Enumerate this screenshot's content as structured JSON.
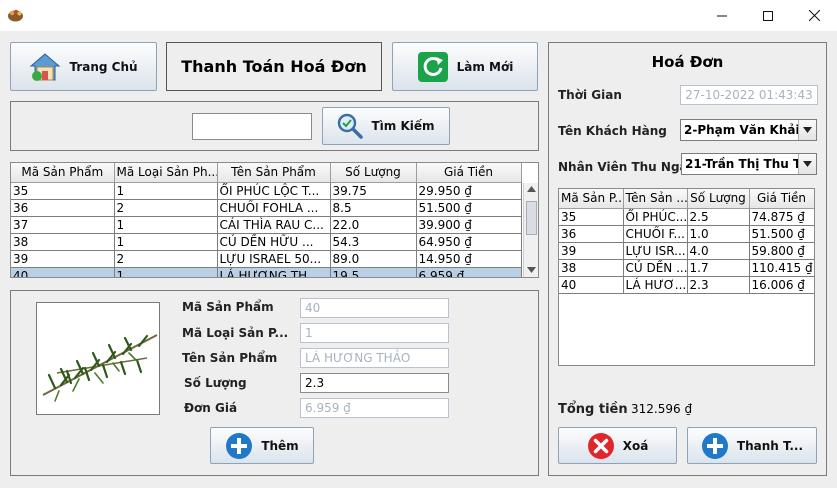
{
  "window": {
    "minimize_glyph": "—",
    "maximize_glyph": "☐",
    "close_glyph": "✕"
  },
  "header": {
    "home_label": "Trang Chủ",
    "page_title": "Thanh Toán Hoá Đơn",
    "refresh_label": "Làm Mới"
  },
  "search": {
    "value": "",
    "button_label": "Tìm Kiếm"
  },
  "product_table": {
    "columns": [
      "Mã Sản Phẩm",
      "Mã Loại Sản Ph...",
      "Tên Sản Phẩm",
      "Số Lượng",
      "Giá Tiền"
    ],
    "rows": [
      [
        "35",
        "1",
        "ỔI PHÚC LỘC T...",
        "39.75",
        "29.950 ₫"
      ],
      [
        "36",
        "2",
        "CHUỐI FOHLA ...",
        "8.5",
        "51.500 ₫"
      ],
      [
        "37",
        "1",
        "CẢI THÌA RAU C...",
        "22.0",
        "39.900 ₫"
      ],
      [
        "38",
        "1",
        "CỦ DỀN HỮU ...",
        "54.3",
        "64.950 ₫"
      ],
      [
        "39",
        "2",
        "LỰU ISRAEL 50...",
        "89.0",
        "14.950 ₫"
      ],
      [
        "40",
        "1",
        "LÁ HƯƠNG TH...",
        "19.5",
        "6.959 ₫"
      ]
    ],
    "selected_index": 5
  },
  "detail": {
    "labels": {
      "product_id": "Mã Sản Phẩm",
      "category_id": "Mã Loại Sản P...",
      "product_name": "Tên Sản Phẩm",
      "quantity": "Số Lượng",
      "unit_price": "Đơn Giá"
    },
    "values": {
      "product_id": "40",
      "category_id": "1",
      "product_name": "LÁ HƯƠNG THẢO",
      "quantity": "2.3",
      "unit_price": "6.959 ₫"
    },
    "add_label": "Thêm"
  },
  "invoice": {
    "title": "Hoá Đơn",
    "time_label": "Thời Gian",
    "time_value": "27-10-2022 01:43:43",
    "customer_label": "Tên Khách Hàng",
    "customer_value": "2-Phạm Văn Khải",
    "cashier_label": "Nhân Viên Thu Ngân",
    "cashier_value": "21-Trần Thị Thu T...",
    "columns": [
      "Mã Sản P...",
      "Tên Sản ...",
      "Số Lượng",
      "Giá Tiền"
    ],
    "rows": [
      [
        "35",
        "ỔI PHÚC...",
        "2.5",
        "74.875 ₫"
      ],
      [
        "36",
        "CHUỐI F...",
        "1.0",
        "51.500 ₫"
      ],
      [
        "39",
        "LỰU ISR...",
        "4.0",
        "59.800 ₫"
      ],
      [
        "38",
        "CỦ DỀN ...",
        "1.7",
        "110.415 ₫"
      ],
      [
        "40",
        "LÁ HƯƠ...",
        "2.3",
        "16.006 ₫"
      ]
    ],
    "total_label": "Tổng tiền",
    "total_value": "312.596 ₫",
    "delete_label": "Xoá",
    "pay_label": "Thanh T..."
  }
}
